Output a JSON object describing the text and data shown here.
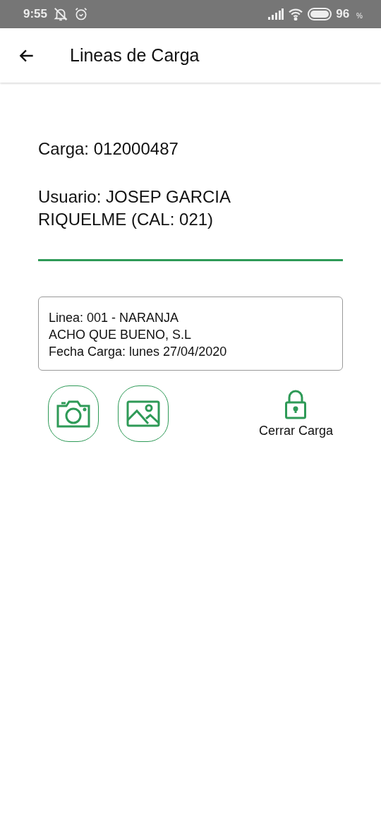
{
  "status_bar": {
    "time": "9:55",
    "battery": "96",
    "battery_unit": "%"
  },
  "app_bar": {
    "title": "Lineas de Carga"
  },
  "load": {
    "carga": "Carga: 012000487",
    "usuario": "Usuario: JOSEP GARCIA RIQUELME (CAL: 021)"
  },
  "line_card": {
    "lines": [
      "Linea: 001 - NARANJA",
      "ACHO QUE BUENO, S.L",
      "Fecha Carga: lunes 27/04/2020"
    ]
  },
  "actions": [
    {
      "kind": "camera"
    },
    {
      "kind": "gallery"
    }
  ],
  "close_action": {
    "label": "Cerrar Carga"
  }
}
